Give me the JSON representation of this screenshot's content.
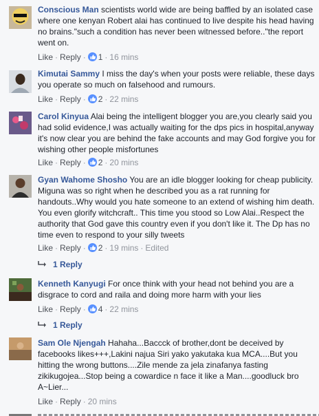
{
  "comments": [
    {
      "author": "Conscious Man",
      "text": "scientists world wide are being baffled by an isolated case where one kenyan Robert alai has continued to live despite his head having no brains.\"such a condition has never been witnessed before..\"the report went on.",
      "like": "Like",
      "reply": "Reply",
      "reactions": "1",
      "time": "16 mins",
      "avatar_icon": "avatar-icon"
    },
    {
      "author": "Kimutai Sammy",
      "text": "I miss the day's when your posts were reliable, these days you operate so much on falsehood and rumours.",
      "like": "Like",
      "reply": "Reply",
      "reactions": "2",
      "time": "22 mins",
      "avatar_icon": "avatar-icon"
    },
    {
      "author": "Carol Kinyua",
      "text": "Alai being the intelligent blogger you are,you clearly said you had solid evidence,I was actually waiting for the dps pics in hospital,anyway it's now clear you are behind the fake accounts and may God forgive you for wishing other people misfortunes",
      "like": "Like",
      "reply": "Reply",
      "reactions": "2",
      "time": "20 mins",
      "avatar_icon": "avatar-icon"
    },
    {
      "author": "Gyan Wahome Shosho",
      "text": "You are an idle blogger looking for cheap publicity. Miguna was so right when he described you as a rat running for handouts..Why would you hate someone to an extend of wishing him death. You even glorify witchcraft.. This time you stood so Low Alai..Respect the authority that God gave this country even if you don't like it. The Dp has no time even to respond to your silly tweets",
      "like": "Like",
      "reply": "Reply",
      "reactions": "2",
      "time": "19 mins",
      "edited": "Edited",
      "replies": "1 Reply",
      "avatar_icon": "avatar-icon"
    },
    {
      "author": "Kenneth Kanyugi",
      "text": "For once think with your head not behind you are a disgrace to cord and raila and doing more harm with your lies",
      "like": "Like",
      "reply": "Reply",
      "reactions": "4",
      "time": "22 mins",
      "replies": "1 Reply",
      "avatar_icon": "avatar-icon"
    },
    {
      "author": "Sam Ole Njengah",
      "text": "Hahaha...Baccck of brother,dont be deceived by facebooks likes+++,Lakini najua Siri yako yakutaka kua MCA....But you hitting the wrong buttons....Zile mende za jela zinafanya fasting zikikugojea...Stop being a cowardice n face it like a Man....goodluck bro A~Lier...",
      "like": "Like",
      "reply": "Reply",
      "time": "20 mins",
      "avatar_icon": "avatar-icon"
    }
  ],
  "colors": {
    "author": "#365899",
    "text": "#1d2129",
    "meta": "#90949c",
    "background": "#f6f7f9",
    "like_reaction": "#5890ff",
    "love_reaction": "#f25268"
  }
}
